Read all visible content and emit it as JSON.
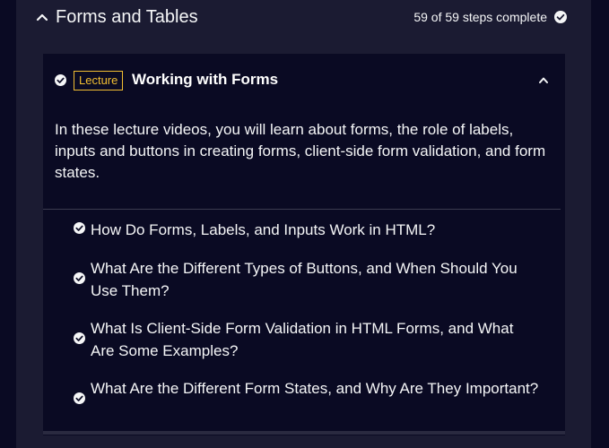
{
  "block": {
    "title": "Forms and Tables",
    "progress": "59 of 59 steps complete"
  },
  "lecture": {
    "badge": "Lecture",
    "title": "Working with Forms",
    "description": "In these lecture videos, you will learn about forms, the role of labels, inputs and buttons in creating forms, client-side form validation, and form states.",
    "steps": [
      {
        "label": "How Do Forms, Labels, and Inputs Work in HTML?",
        "completed": true
      },
      {
        "label": "What Are the Different Types of Buttons, and When Should You Use Them?",
        "completed": true
      },
      {
        "label": "What Is Client-Side Form Validation in HTML Forms, and What Are Some Examples?",
        "completed": true
      },
      {
        "label": "What Are the Different Form States, and Why Are They Important?",
        "completed": true
      }
    ]
  },
  "icons": {
    "header_chevron": "chevron-up-icon",
    "complete": "check-circle-icon",
    "lecture_chevron": "chevron-up-icon"
  },
  "colors": {
    "background": "#0a0a23",
    "panel": "#1b1b32",
    "badge_accent": "#f1be32",
    "text": "#f5f6f7"
  }
}
